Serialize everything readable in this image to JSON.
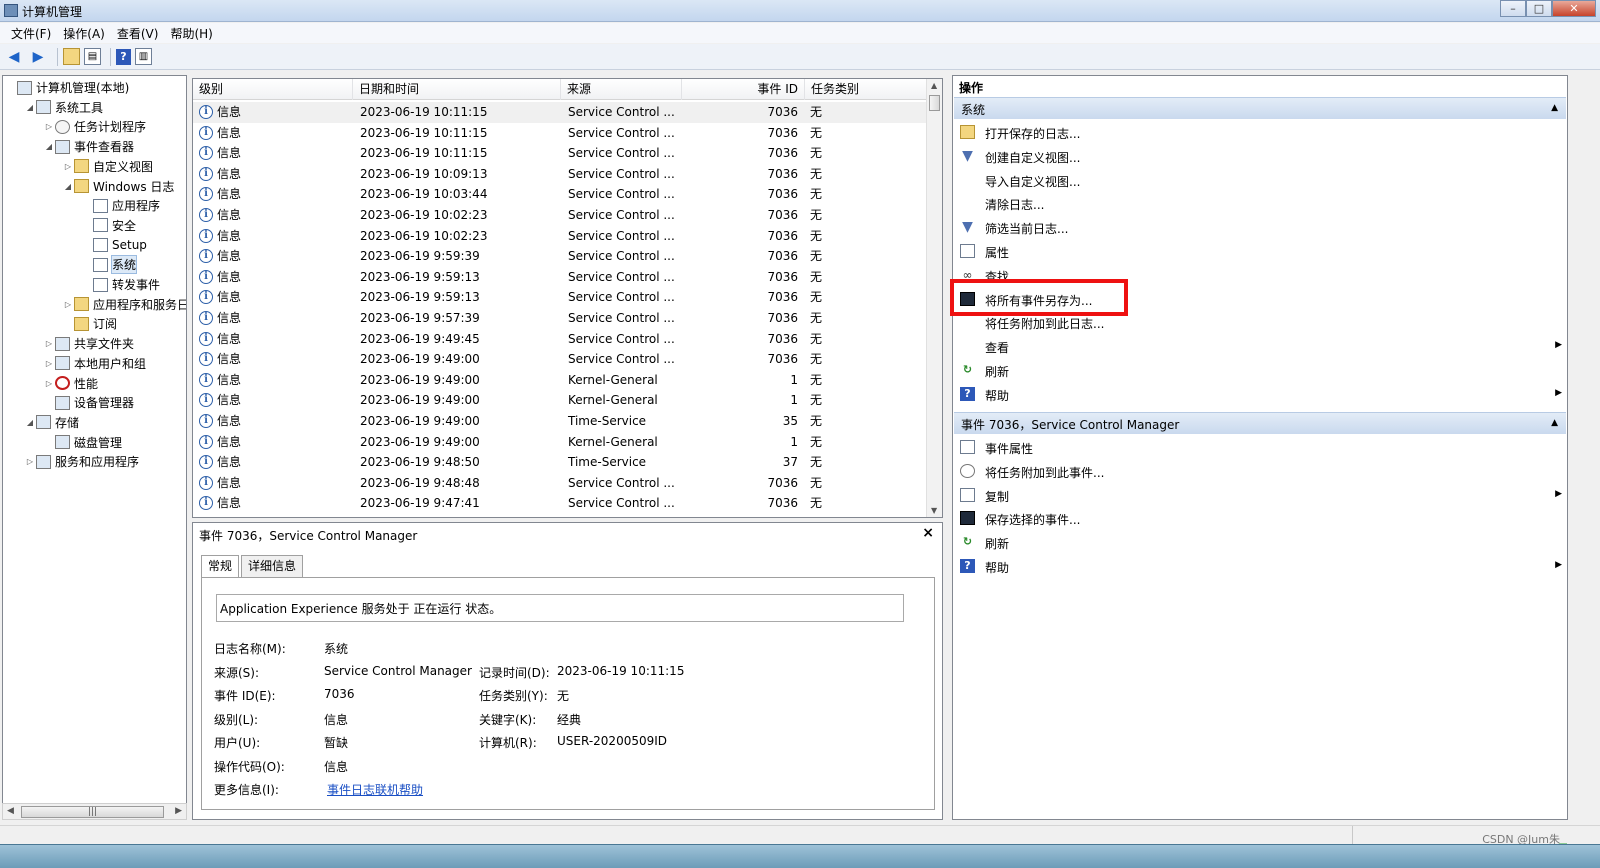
{
  "window": {
    "title": "计算机管理"
  },
  "menu": [
    "文件(F)",
    "操作(A)",
    "查看(V)",
    "帮助(H)"
  ],
  "tree": [
    {
      "label": "计算机管理(本地)",
      "indent": 0,
      "arrow": "",
      "icon": "computer-icon"
    },
    {
      "label": "系统工具",
      "indent": 1,
      "arrow": "▲",
      "icon": "tools-icon"
    },
    {
      "label": "任务计划程序",
      "indent": 2,
      "arrow": "▷",
      "icon": "clock-icon"
    },
    {
      "label": "事件查看器",
      "indent": 2,
      "arrow": "▲",
      "icon": "event-viewer-icon"
    },
    {
      "label": "自定义视图",
      "indent": 3,
      "arrow": "▷",
      "icon": "folder-icon"
    },
    {
      "label": "Windows 日志",
      "indent": 3,
      "arrow": "▲",
      "icon": "folder-icon"
    },
    {
      "label": "应用程序",
      "indent": 4,
      "arrow": "",
      "icon": "log-icon"
    },
    {
      "label": "安全",
      "indent": 4,
      "arrow": "",
      "icon": "log-icon"
    },
    {
      "label": "Setup",
      "indent": 4,
      "arrow": "",
      "icon": "log-icon"
    },
    {
      "label": "系统",
      "indent": 4,
      "arrow": "",
      "icon": "log-icon",
      "selected": true
    },
    {
      "label": "转发事件",
      "indent": 4,
      "arrow": "",
      "icon": "log-icon"
    },
    {
      "label": "应用程序和服务日志",
      "indent": 3,
      "arrow": "▷",
      "icon": "folder-icon"
    },
    {
      "label": "订阅",
      "indent": 3,
      "arrow": "",
      "icon": "folder-icon"
    },
    {
      "label": "共享文件夹",
      "indent": 2,
      "arrow": "▷",
      "icon": "share-icon"
    },
    {
      "label": "本地用户和组",
      "indent": 2,
      "arrow": "▷",
      "icon": "users-icon"
    },
    {
      "label": "性能",
      "indent": 2,
      "arrow": "▷",
      "icon": "performance-icon"
    },
    {
      "label": "设备管理器",
      "indent": 2,
      "arrow": "",
      "icon": "device-icon"
    },
    {
      "label": "存储",
      "indent": 1,
      "arrow": "▲",
      "icon": "storage-icon"
    },
    {
      "label": "磁盘管理",
      "indent": 2,
      "arrow": "",
      "icon": "disk-icon"
    },
    {
      "label": "服务和应用程序",
      "indent": 1,
      "arrow": "▷",
      "icon": "services-icon"
    }
  ],
  "list": {
    "columns": [
      "级别",
      "日期和时间",
      "来源",
      "事件 ID",
      "任务类别"
    ],
    "rows": [
      [
        "信息",
        "2023-06-19 10:11:15",
        "Service Control ...",
        "7036",
        "无"
      ],
      [
        "信息",
        "2023-06-19 10:11:15",
        "Service Control ...",
        "7036",
        "无"
      ],
      [
        "信息",
        "2023-06-19 10:11:15",
        "Service Control ...",
        "7036",
        "无"
      ],
      [
        "信息",
        "2023-06-19 10:09:13",
        "Service Control ...",
        "7036",
        "无"
      ],
      [
        "信息",
        "2023-06-19 10:03:44",
        "Service Control ...",
        "7036",
        "无"
      ],
      [
        "信息",
        "2023-06-19 10:02:23",
        "Service Control ...",
        "7036",
        "无"
      ],
      [
        "信息",
        "2023-06-19 10:02:23",
        "Service Control ...",
        "7036",
        "无"
      ],
      [
        "信息",
        "2023-06-19 9:59:39",
        "Service Control ...",
        "7036",
        "无"
      ],
      [
        "信息",
        "2023-06-19 9:59:13",
        "Service Control ...",
        "7036",
        "无"
      ],
      [
        "信息",
        "2023-06-19 9:59:13",
        "Service Control ...",
        "7036",
        "无"
      ],
      [
        "信息",
        "2023-06-19 9:57:39",
        "Service Control ...",
        "7036",
        "无"
      ],
      [
        "信息",
        "2023-06-19 9:49:45",
        "Service Control ...",
        "7036",
        "无"
      ],
      [
        "信息",
        "2023-06-19 9:49:00",
        "Service Control ...",
        "7036",
        "无"
      ],
      [
        "信息",
        "2023-06-19 9:49:00",
        "Kernel-General",
        "1",
        "无"
      ],
      [
        "信息",
        "2023-06-19 9:49:00",
        "Kernel-General",
        "1",
        "无"
      ],
      [
        "信息",
        "2023-06-19 9:49:00",
        "Time-Service",
        "35",
        "无"
      ],
      [
        "信息",
        "2023-06-19 9:49:00",
        "Kernel-General",
        "1",
        "无"
      ],
      [
        "信息",
        "2023-06-19 9:48:50",
        "Time-Service",
        "37",
        "无"
      ],
      [
        "信息",
        "2023-06-19 9:48:48",
        "Service Control ...",
        "7036",
        "无"
      ],
      [
        "信息",
        "2023-06-19 9:47:41",
        "Service Control ...",
        "7036",
        "无"
      ]
    ]
  },
  "details": {
    "title": "事件 7036，Service Control Manager",
    "close": "×",
    "tabs": [
      "常规",
      "详细信息"
    ],
    "description": "Application Experience 服务处于 正在运行 状态。",
    "fields": {
      "log_name_label": "日志名称(M):",
      "log_name": "系统",
      "source_label": "来源(S):",
      "source": "Service Control Manager",
      "logged_label": "记录时间(D):",
      "logged": "2023-06-19 10:11:15",
      "event_id_label": "事件 ID(E):",
      "event_id": "7036",
      "task_label": "任务类别(Y):",
      "task": "无",
      "level_label": "级别(L):",
      "level": "信息",
      "keywords_label": "关键字(K):",
      "keywords": "经典",
      "user_label": "用户(U):",
      "user": "暂缺",
      "computer_label": "计算机(R):",
      "computer": "USER-20200509ID",
      "opcode_label": "操作代码(O):",
      "opcode": "信息",
      "more_label": "更多信息(I):",
      "more_link": "事件日志联机帮助"
    }
  },
  "actions": {
    "title": "操作",
    "section1": "系统",
    "items1": [
      {
        "label": "打开保存的日志...",
        "icon": "open-log-icon",
        "cls": "ic-open",
        "glyph": ""
      },
      {
        "label": "创建自定义视图...",
        "icon": "filter-icon",
        "cls": "ic-filter",
        "glyph": "▼"
      },
      {
        "label": "导入自定义视图...",
        "icon": "import-icon",
        "cls": "",
        "glyph": ""
      },
      {
        "label": "清除日志...",
        "icon": "clear-icon",
        "cls": "",
        "glyph": ""
      },
      {
        "label": "筛选当前日志...",
        "icon": "filter-icon",
        "cls": "ic-filter",
        "glyph": "▼"
      },
      {
        "label": "属性",
        "icon": "properties-icon",
        "cls": "ic-doc",
        "glyph": ""
      },
      {
        "label": "查找...",
        "icon": "binoculars-icon",
        "cls": "ic-binoc",
        "glyph": "∞"
      },
      {
        "label": "将所有事件另存为...",
        "icon": "save-icon",
        "cls": "ic-save",
        "glyph": ""
      },
      {
        "label": "将任务附加到此日志...",
        "icon": "attach-task-icon",
        "cls": "",
        "glyph": ""
      },
      {
        "label": "查看",
        "icon": "view-icon",
        "cls": "",
        "glyph": "",
        "sub": "▶"
      },
      {
        "label": "刷新",
        "icon": "refresh-icon",
        "cls": "ic-refresh",
        "glyph": "↻"
      },
      {
        "label": "帮助",
        "icon": "help-icon",
        "cls": "ic-help",
        "glyph": "?",
        "sub": "▶"
      }
    ],
    "section2": "事件 7036，Service Control Manager",
    "items2": [
      {
        "label": "事件属性",
        "icon": "event-properties-icon",
        "cls": "ic-doc",
        "glyph": ""
      },
      {
        "label": "将任务附加到此事件...",
        "icon": "attach-task-icon",
        "cls": "ic-clock",
        "glyph": ""
      },
      {
        "label": "复制",
        "icon": "copy-icon",
        "cls": "ic-doc",
        "glyph": "",
        "sub": "▶"
      },
      {
        "label": "保存选择的事件...",
        "icon": "save-icon",
        "cls": "ic-save",
        "glyph": ""
      },
      {
        "label": "刷新",
        "icon": "refresh-icon",
        "cls": "ic-refresh",
        "glyph": "↻"
      },
      {
        "label": "帮助",
        "icon": "help-icon",
        "cls": "ic-help",
        "glyph": "?",
        "sub": "▶"
      }
    ]
  },
  "watermark": "CSDN @Jum朱",
  "colors": {
    "highlight": "#ee1111",
    "link": "#1a4fc4",
    "section": "#c9d9ee"
  }
}
